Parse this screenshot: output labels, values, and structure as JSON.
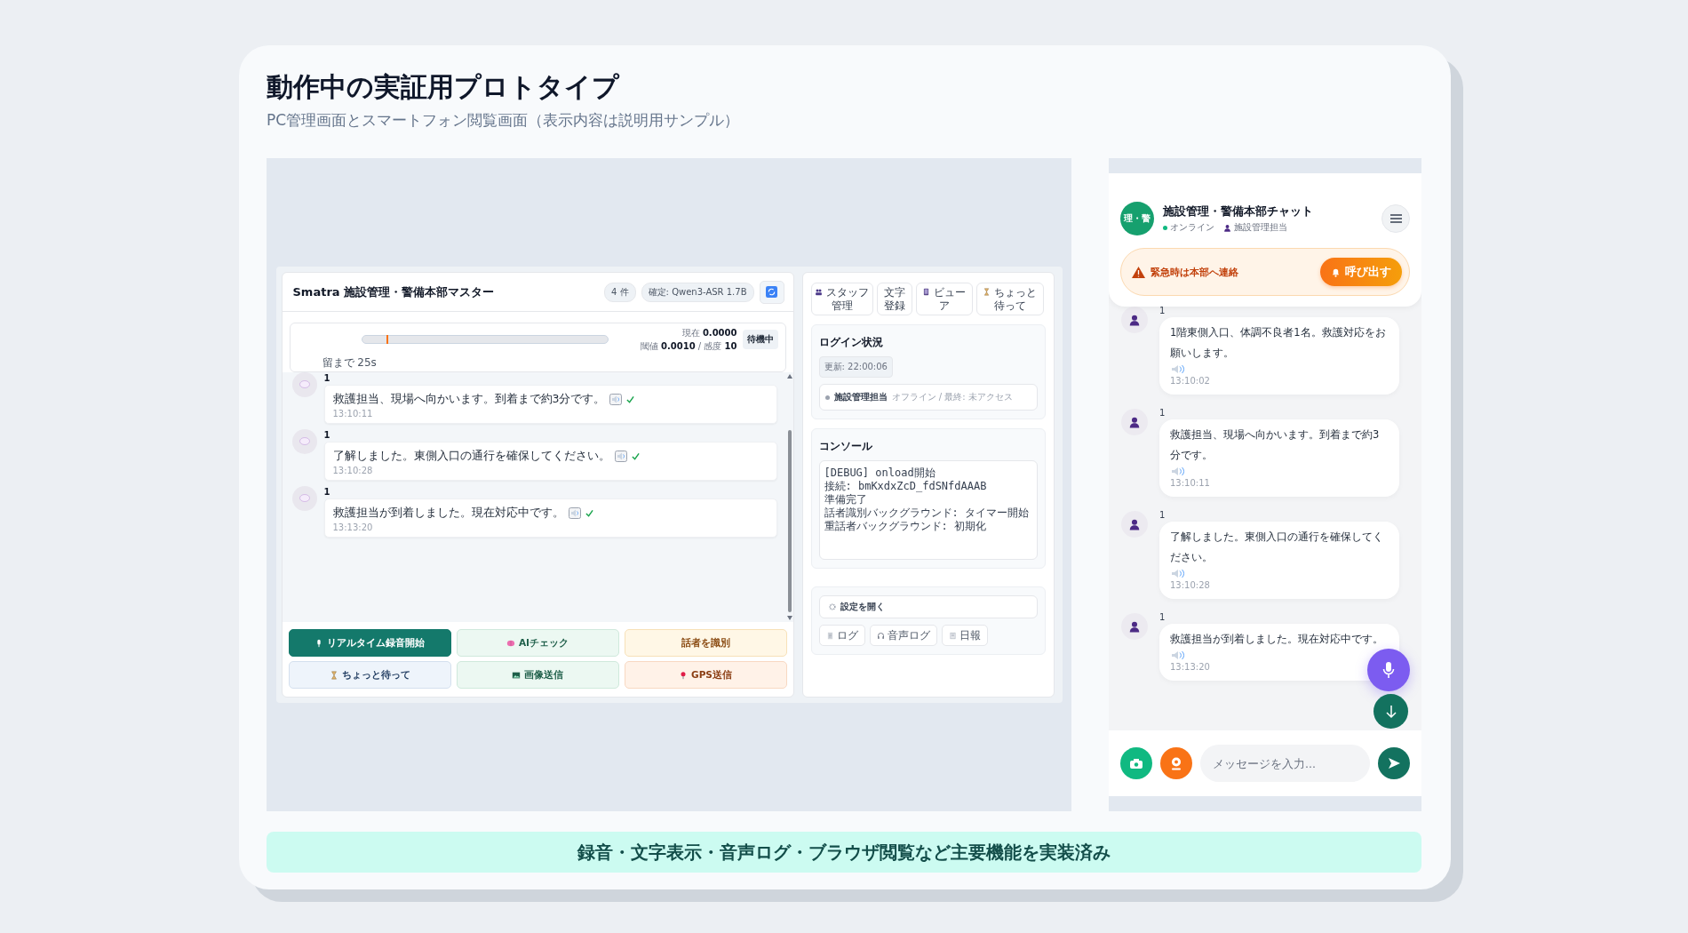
{
  "slide": {
    "title": "動作中の実証用プロトタイプ",
    "subtitle": "PC管理画面とスマートフォン閲覧画面（表示内容は説明用サンプル）"
  },
  "pc_app": {
    "title": "Smatra 施設管理・警備本部マスター",
    "badges": [
      "4 件",
      "確定: Qwen3-ASR 1.7B"
    ],
    "meter": {
      "level": 0.1,
      "current": "現在 **0.0000**",
      "threshold": "閾値 **0.0010** / 感度 **10**",
      "status": "待機中",
      "countdown": "留まで 25s"
    },
    "messages": [
      {
        "speaker": "1",
        "text": "救護担当、現場へ向かいます。到着まで約3分です。",
        "time": "13:10:11",
        "verified": true
      },
      {
        "speaker": "1",
        "text": "了解しました。東側入口の通行を確保してください。",
        "time": "13:10:28",
        "verified": true
      },
      {
        "speaker": "1",
        "text": "救護担当が到着しました。現在対応中です。",
        "time": "13:13:20",
        "verified": true
      }
    ],
    "buttons": [
      {
        "label": "リアルタイム録音開始",
        "kind": "primary"
      },
      {
        "label": "AIチェック",
        "kind": "mint"
      },
      {
        "label": "話者を識別",
        "kind": "amber"
      },
      {
        "label": "ちょっと待って",
        "kind": "blue"
      },
      {
        "label": "画像送信",
        "kind": "mint"
      },
      {
        "label": "GPS送信",
        "kind": "peach"
      }
    ]
  },
  "side_panel": {
    "tools": [
      {
        "label": "スタッフ管理"
      },
      {
        "label": "文字登録"
      },
      {
        "label": "ビューア"
      },
      {
        "label": "ちょっと待って"
      }
    ],
    "login": {
      "title": "ログイン状況",
      "updated": "更新: 22:00:06",
      "users": [
        {
          "name": "施設管理担当",
          "status": "オフライン / 最終: 未アクセス",
          "online": false
        }
      ]
    },
    "console": {
      "title": "コンソール",
      "lines": [
        "[DEBUG] onload開始",
        "接続: bmKxdxZcD_fdSNfdAAAB",
        "準備完了",
        "話者識別バックグラウンド: タイマー開始",
        "重話者バックグラウンド: 初期化"
      ]
    },
    "settings": {
      "label": "設定を開く"
    },
    "links": [
      {
        "label": "ログ"
      },
      {
        "label": "音声ログ"
      },
      {
        "label": "日報"
      }
    ]
  },
  "phone": {
    "logo": "理・警",
    "title": "施設管理・警備本部チャット",
    "status": "オンライン",
    "online": true,
    "user": "施設管理担当",
    "alert": {
      "text": "緊急時は本部へ連絡",
      "button": "呼び出す"
    },
    "messages": [
      {
        "speaker": "1",
        "text": "1階東側入口、体調不良者1名。救護対応をお願いします。",
        "time": "13:10:02"
      },
      {
        "speaker": "1",
        "text": "救護担当、現場へ向かいます。到着まで約3分です。",
        "time": "13:10:11"
      },
      {
        "speaker": "1",
        "text": "了解しました。東側入口の通行を確保してください。",
        "time": "13:10:28"
      },
      {
        "speaker": "1",
        "text": "救護担当が到着しました。現在対応中です。",
        "time": "13:13:20"
      }
    ],
    "input": {
      "placeholder": "メッセージを入力..."
    }
  },
  "banner": "録音・文字表示・音声ログ・ブラウザ閲覧など主要機能を実装済み"
}
